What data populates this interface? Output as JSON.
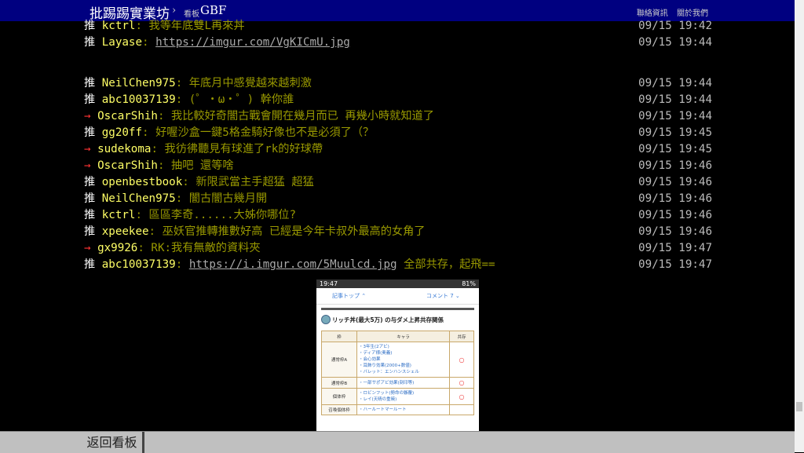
{
  "header": {
    "site_title": "批踢踢實業坊",
    "separator": "›",
    "board_prefix": "看板",
    "board_name": "GBF",
    "links": [
      "聯絡資訊",
      "關於我們"
    ]
  },
  "pushes": [
    {
      "tag": "推",
      "user": "kctrl",
      "content": ": 我等年底雙L再來丼",
      "link": "",
      "after": "",
      "time": "09/15 19:42"
    },
    {
      "tag": "推",
      "user": "Layase",
      "content": ": ",
      "link": "https://imgur.com/VgKICmU.jpg",
      "after": "",
      "time": "09/15 19:44"
    },
    {
      "tag": "推",
      "user": "NeilChen975",
      "content": ": 年底月中感覺越來越刺激",
      "link": "",
      "after": "",
      "time": "09/15 19:44"
    },
    {
      "tag": "推",
      "user": "abc10037139",
      "content": ": (゜・ω・゜) 幹你誰",
      "link": "",
      "after": "",
      "time": "09/15 19:44"
    },
    {
      "tag": "→",
      "user": "OscarShih",
      "content": ": 我比較好奇闇古戰會開在幾月而已 再幾小時就知道了",
      "link": "",
      "after": "",
      "time": "09/15 19:44"
    },
    {
      "tag": "推",
      "user": "gg20ff",
      "content": ": 好喔沙盒一鍵5格金騎好像也不是必須了（？",
      "link": "",
      "after": "",
      "time": "09/15 19:45"
    },
    {
      "tag": "→",
      "user": "sudekoma",
      "content": ": 我彷彿聽見有球進了rk的好球帶",
      "link": "",
      "after": "",
      "time": "09/15 19:45"
    },
    {
      "tag": "→",
      "user": "OscarShih",
      "content": ": 抽吧 還等啥",
      "link": "",
      "after": "",
      "time": "09/15 19:46"
    },
    {
      "tag": "推",
      "user": "openbestbook",
      "content": ": 新限武當主手超猛 超猛",
      "link": "",
      "after": "",
      "time": "09/15 19:46"
    },
    {
      "tag": "推",
      "user": "NeilChen975",
      "content": ": 闇古闇古幾月開",
      "link": "",
      "after": "",
      "time": "09/15 19:46"
    },
    {
      "tag": "推",
      "user": "kctrl",
      "content": ": 區區李奇......大姊你哪位?",
      "link": "",
      "after": "",
      "time": "09/15 19:46"
    },
    {
      "tag": "推",
      "user": "xpeekee",
      "content": ": 巫妖官推轉推數好高 已經是今年卡叔外最高的女角了",
      "link": "",
      "after": "",
      "time": "09/15 19:46"
    },
    {
      "tag": "→",
      "user": "gx9926",
      "content": ": RK:我有無敵的資料夾",
      "link": "",
      "after": "",
      "time": "09/15 19:47"
    },
    {
      "tag": "推",
      "user": "abc10037139",
      "content": ": ",
      "link": "https://i.imgur.com/5Muulcd.jpg",
      "after": " 全部共存，起飛==",
      "time": "09/15 19:47"
    }
  ],
  "preview": {
    "status_time": "19:47",
    "status_right": "81%",
    "tab_left": "記事トップ ⌃",
    "tab_right": "コメント 7 ⌄",
    "title": "リッチ丼(最大5万) の与ダメ上昇共存関係",
    "columns": [
      "枠",
      "キャラ",
      "共存"
    ],
    "rows": [
      {
        "frame": "通常枠A",
        "chars": "・3年生(2アビ)\n・ディア様(奥義)\n・会心効果\n・耳飾り効果(2000+数値)\n・バレット：エンハンスシェル",
        "coexist": "○"
      },
      {
        "frame": "通常枠B",
        "chars": "・一部サポアビ効果(刻印等)",
        "coexist": "○"
      },
      {
        "frame": "個体枠",
        "chars": "・ロビンフット(勢命の鏃覆)\n・レイ(天晴の重暁)",
        "coexist": "○"
      },
      {
        "frame": "召喚個体枠",
        "chars": "・ハールートマールート",
        "coexist": ""
      }
    ]
  },
  "footer": {
    "back_label": "返回看板"
  },
  "colors": {
    "header_bg": "#000080",
    "push_user": "#ffff66",
    "push_content": "#999900",
    "arrow_tag": "#ff3333"
  }
}
